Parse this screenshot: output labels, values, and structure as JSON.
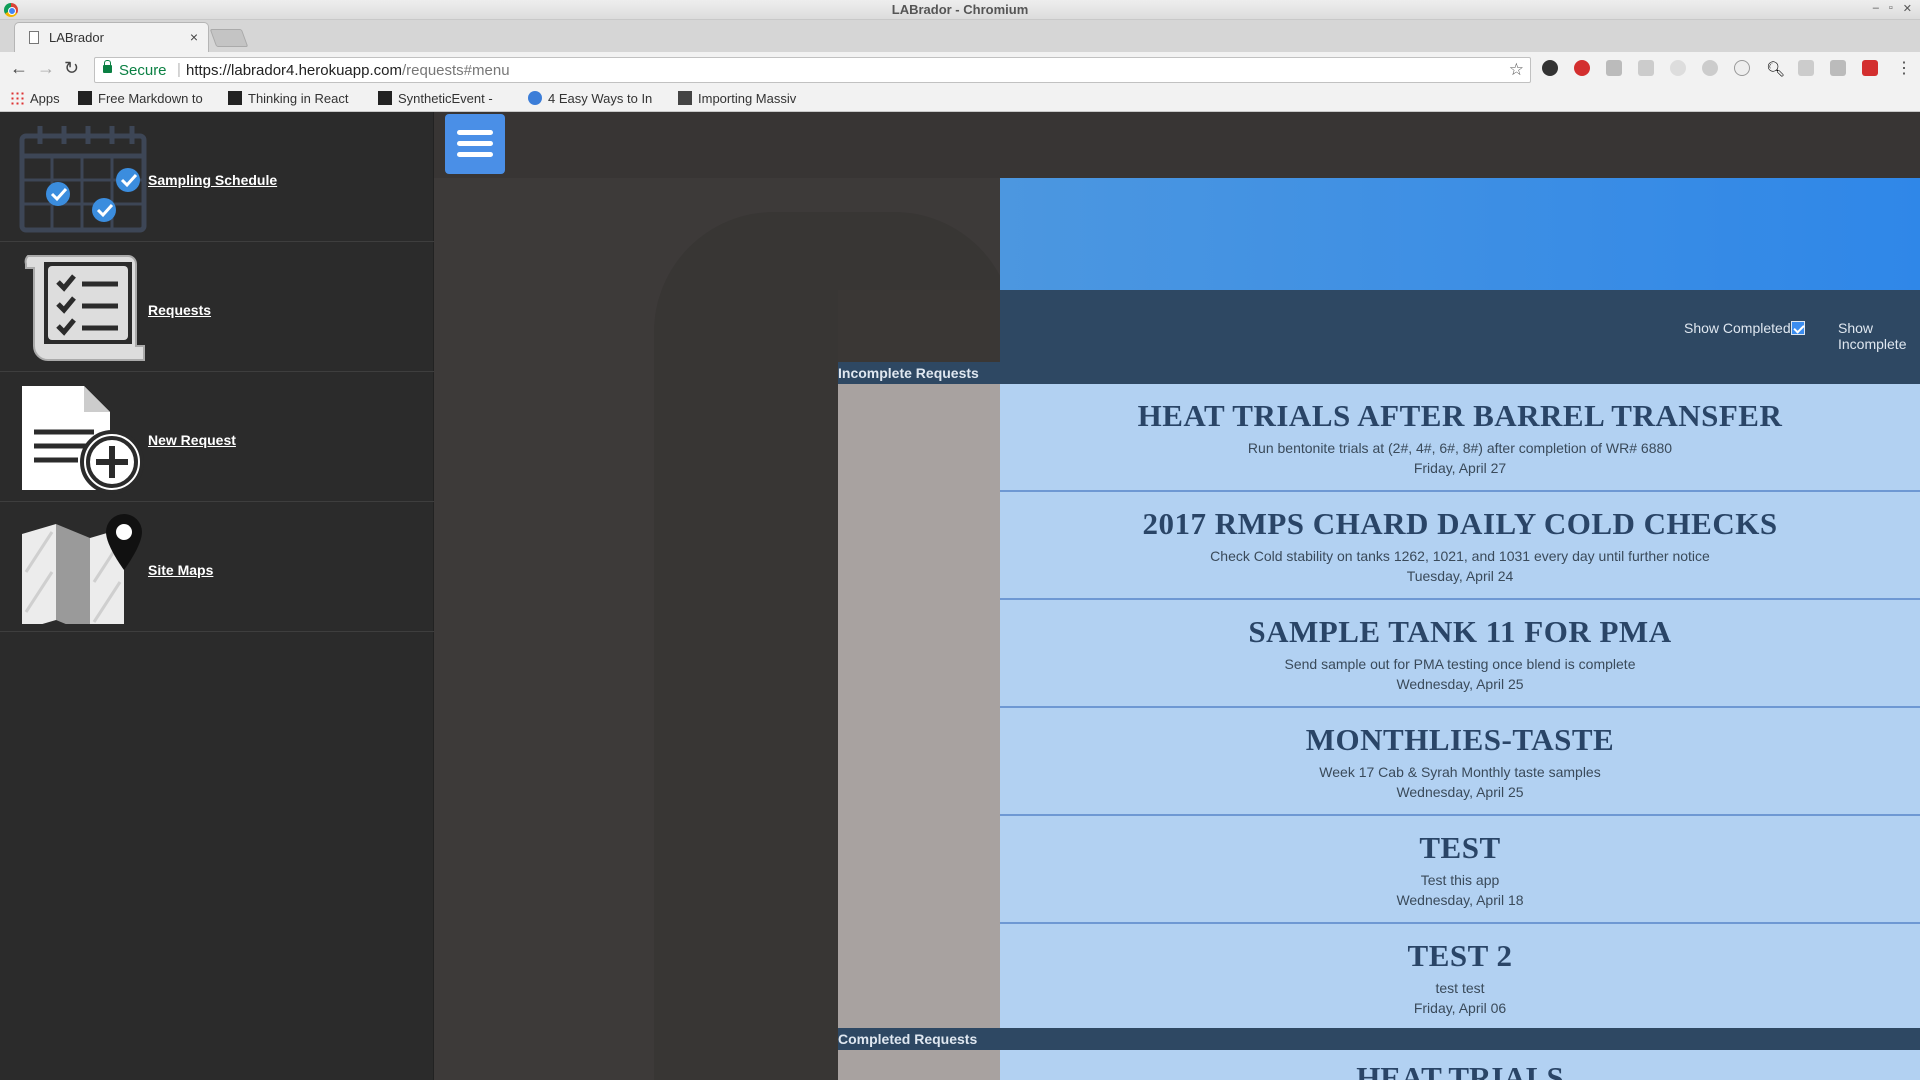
{
  "window": {
    "title": "LABrador - Chromium"
  },
  "tab": {
    "title": "LABrador",
    "close": "×"
  },
  "toolbar": {
    "secure_label": "Secure",
    "url_origin": "https://labrador4.herokuapp.com",
    "url_path": "/requests#menu"
  },
  "bookmarks": [
    {
      "label": "Apps"
    },
    {
      "label": "Free Markdown to"
    },
    {
      "label": "Thinking in React"
    },
    {
      "label": "SyntheticEvent -"
    },
    {
      "label": "4 Easy Ways to In"
    },
    {
      "label": "Importing Massiv"
    }
  ],
  "sidebar": {
    "items": [
      {
        "label": "Sampling Schedule",
        "icon": "calendar-check-icon"
      },
      {
        "label": "Requests",
        "icon": "checklist-scroll-icon"
      },
      {
        "label": "New Request",
        "icon": "new-document-icon"
      },
      {
        "label": "Site Maps",
        "icon": "map-pin-icon"
      }
    ]
  },
  "filters": {
    "show_completed": "Show Completed",
    "show_incomplete": "Show Incomplete"
  },
  "sections": {
    "incomplete": "Incomplete Requests",
    "completed": "Completed Requests"
  },
  "requests": [
    {
      "title": "HEAT TRIALS AFTER BARREL TRANSFER",
      "desc": "Run bentonite trials at (2#, 4#, 6#, 8#) after completion of WR# 6880",
      "date": "Friday, April 27"
    },
    {
      "title": "2017 RMPS CHARD DAILY COLD CHECKS",
      "desc": "Check Cold stability on tanks 1262, 1021, and 1031 every day until further notice",
      "date": "Tuesday, April 24"
    },
    {
      "title": "SAMPLE TANK 11 FOR PMA",
      "desc": "Send sample out for PMA testing once blend is complete",
      "date": "Wednesday, April 25"
    },
    {
      "title": "MONTHLIES-TASTE",
      "desc": "Week 17 Cab & Syrah Monthly taste samples",
      "date": "Wednesday, April 25"
    },
    {
      "title": "TEST",
      "desc": "Test this app",
      "date": "Wednesday, April 18"
    },
    {
      "title": "TEST 2",
      "desc": "test test",
      "date": "Friday, April 06"
    }
  ],
  "completed_partial_title": "HEAT TRIALS"
}
